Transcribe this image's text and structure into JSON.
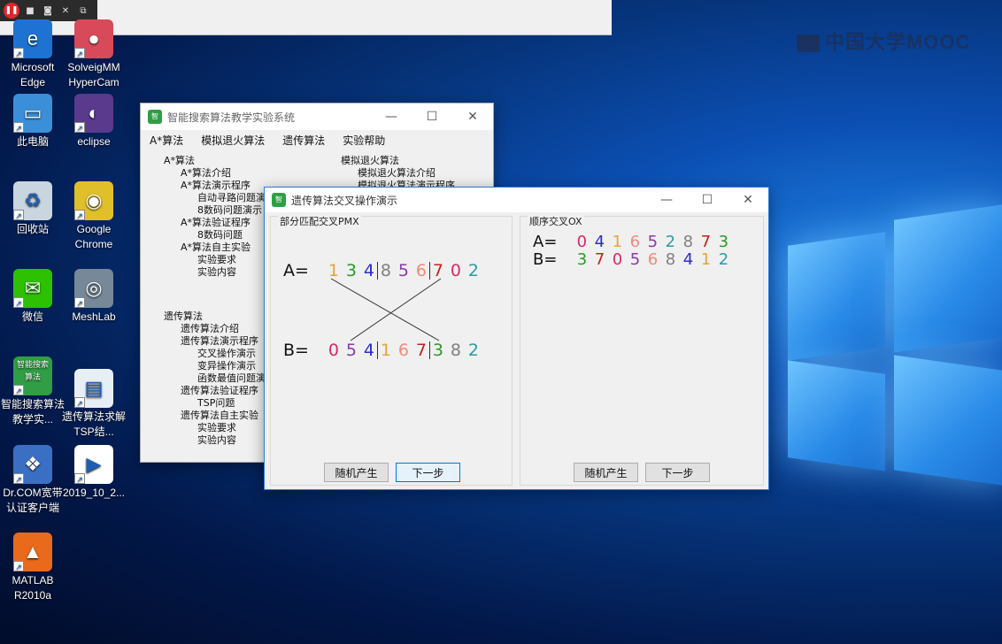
{
  "watermark": "中国大学MOOC",
  "desktop_icons": [
    {
      "label": "Microsoft Edge",
      "color": "#1e73d2",
      "glyph": "e"
    },
    {
      "label": "SolveigMM HyperCam",
      "color": "#d84a5a",
      "glyph": "●"
    },
    {
      "label": "此电脑",
      "color": "#3b8fd9",
      "glyph": "▭"
    },
    {
      "label": "eclipse",
      "color": "#5a3a8c",
      "glyph": "◐"
    },
    {
      "label": "回收站",
      "color": "#c9d6e0",
      "glyph": "♻"
    },
    {
      "label": "Google Chrome",
      "color": "#e0c02a",
      "glyph": "◉"
    },
    {
      "label": "微信",
      "color": "#2dc100",
      "glyph": "✉"
    },
    {
      "label": "MeshLab",
      "color": "#778899",
      "glyph": "◎"
    },
    {
      "label": "智能搜索算法教学实...",
      "color": "#2f9e44",
      "glyph": "智能搜索算法"
    },
    {
      "label": "遗传算法求解TSP结...",
      "color": "#e8eef5",
      "glyph": "▤"
    },
    {
      "label": "Dr.COM宽带认证客户端",
      "color": "#3a6fc4",
      "glyph": "❖"
    },
    {
      "label": "2019_10_2...",
      "color": "#ffffff",
      "glyph": "▶"
    },
    {
      "label": "MATLAB R2010a",
      "color": "#e86a1a",
      "glyph": "▲"
    }
  ],
  "main_window": {
    "title": "智能搜索算法教学实验系统",
    "menu": [
      "A*算法",
      "模拟退火算法",
      "遗传算法",
      "实验帮助"
    ],
    "tree_left": [
      {
        "text": "A*算法",
        "level": 0
      },
      {
        "text": "A*算法介绍",
        "level": 1
      },
      {
        "text": "A*算法演示程序",
        "level": 1
      },
      {
        "text": "自动寻路问题演",
        "level": 2
      },
      {
        "text": "8数码问题演示",
        "level": 2
      },
      {
        "text": "A*算法验证程序",
        "level": 1
      },
      {
        "text": "8数码问题",
        "level": 2
      },
      {
        "text": "A*算法自主实验",
        "level": 1
      },
      {
        "text": "实验要求",
        "level": 2
      },
      {
        "text": "实验内容",
        "level": 2
      }
    ],
    "tree_left2": [
      {
        "text": "遗传算法",
        "level": 0
      },
      {
        "text": "遗传算法介绍",
        "level": 1
      },
      {
        "text": "遗传算法演示程序",
        "level": 1
      },
      {
        "text": "交叉操作演示",
        "level": 2
      },
      {
        "text": "变异操作演示",
        "level": 2
      },
      {
        "text": "函数最值问题演",
        "level": 2
      },
      {
        "text": "遗传算法验证程序",
        "level": 1
      },
      {
        "text": "TSP问题",
        "level": 2
      },
      {
        "text": "遗传算法自主实验",
        "level": 1
      },
      {
        "text": "实验要求",
        "level": 2
      },
      {
        "text": "实验内容",
        "level": 2
      }
    ],
    "tree_right": [
      {
        "text": "模拟退火算法",
        "level": 0
      },
      {
        "text": "模拟退火算法介绍",
        "level": 1
      },
      {
        "text": "模拟退火算法演示程序",
        "level": 1
      }
    ]
  },
  "dialog": {
    "title": "遗传算法交叉操作演示",
    "pmx": {
      "title": "部分匹配交叉PMX",
      "a_label": "A=",
      "b_label": "B=",
      "a": [
        {
          "v": "1",
          "c": "#e8a33a"
        },
        {
          "v": "3",
          "c": "#2a9a2a"
        },
        {
          "v": "4",
          "c": "#2a2ad8"
        },
        {
          "v": "8",
          "c": "#808080"
        },
        {
          "v": "5",
          "c": "#8a3aa8"
        },
        {
          "v": "6",
          "c": "#f08a7a"
        },
        {
          "v": "7",
          "c": "#c82020"
        },
        {
          "v": "0",
          "c": "#d82a6a"
        },
        {
          "v": "2",
          "c": "#2a9aa8"
        }
      ],
      "b": [
        {
          "v": "0",
          "c": "#d82a6a"
        },
        {
          "v": "5",
          "c": "#8a3aa8"
        },
        {
          "v": "4",
          "c": "#2a2ad8"
        },
        {
          "v": "1",
          "c": "#e8a33a"
        },
        {
          "v": "6",
          "c": "#f08a7a"
        },
        {
          "v": "7",
          "c": "#c82020"
        },
        {
          "v": "3",
          "c": "#2a9a2a"
        },
        {
          "v": "8",
          "c": "#808080"
        },
        {
          "v": "2",
          "c": "#2a9aa8"
        }
      ],
      "btn_random": "随机产生",
      "btn_next": "下一步"
    },
    "ox": {
      "title": "顺序交叉OX",
      "a_label": "A=",
      "b_label": "B=",
      "a": [
        {
          "v": "0",
          "c": "#d82a6a"
        },
        {
          "v": "4",
          "c": "#2a2ad8"
        },
        {
          "v": "1",
          "c": "#e8a33a"
        },
        {
          "v": "6",
          "c": "#f08a7a"
        },
        {
          "v": "5",
          "c": "#8a3aa8"
        },
        {
          "v": "2",
          "c": "#2a9aa8"
        },
        {
          "v": "8",
          "c": "#808080"
        },
        {
          "v": "7",
          "c": "#c82020"
        },
        {
          "v": "3",
          "c": "#2a9a2a"
        }
      ],
      "b": [
        {
          "v": "3",
          "c": "#2a9a2a"
        },
        {
          "v": "7",
          "c": "#c82020"
        },
        {
          "v": "0",
          "c": "#d82a6a"
        },
        {
          "v": "5",
          "c": "#8a3aa8"
        },
        {
          "v": "6",
          "c": "#f08a7a"
        },
        {
          "v": "8",
          "c": "#808080"
        },
        {
          "v": "4",
          "c": "#2a2ad8"
        },
        {
          "v": "1",
          "c": "#e8a33a"
        },
        {
          "v": "2",
          "c": "#2a9aa8"
        }
      ],
      "btn_random": "随机产生",
      "btn_next": "下一步"
    }
  }
}
